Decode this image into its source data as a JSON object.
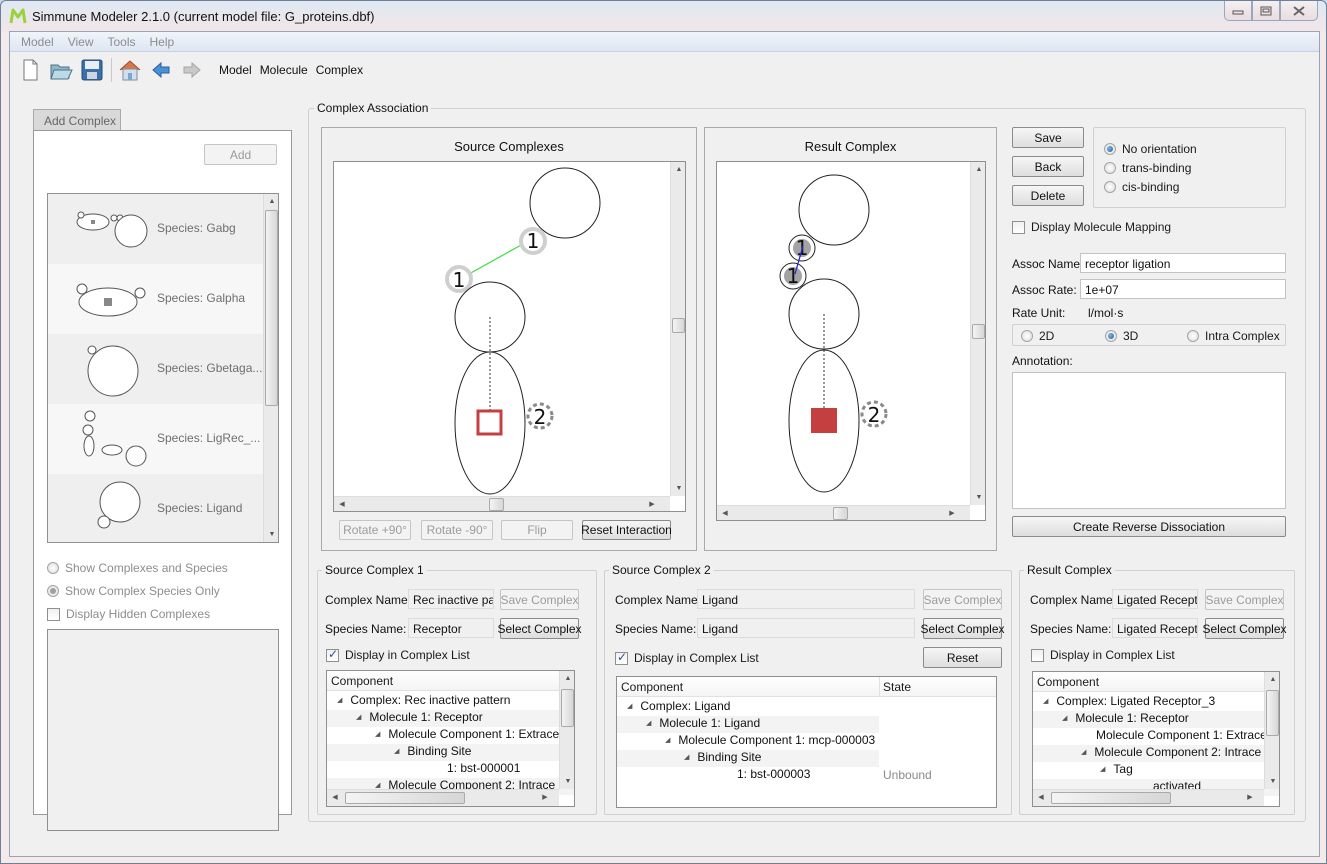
{
  "window": {
    "title": "Simmune Modeler  2.1.0 (current model file: G_proteins.dbf)",
    "controls": [
      "minimize",
      "maximize",
      "close"
    ]
  },
  "menubar": [
    "Model",
    "View",
    "Tools",
    "Help"
  ],
  "toolbar": {
    "icons": [
      "new-file-icon",
      "open-folder-icon",
      "save-disk-icon",
      "home-icon",
      "back-arrow-icon",
      "forward-arrow-icon"
    ],
    "links": [
      "Model",
      "Molecule",
      "Complex"
    ]
  },
  "left_panel": {
    "tab_label": "Add Complex",
    "add_button": "Add",
    "species": [
      {
        "label": "Species: Gabg"
      },
      {
        "label": "Species: Galpha"
      },
      {
        "label": "Species: Gbetaga..."
      },
      {
        "label": "Species: LigRec_..."
      },
      {
        "label": "Species: Ligand"
      }
    ],
    "options": {
      "show_complexes_and_species": "Show Complexes and Species",
      "show_complex_species_only": "Show Complex Species Only",
      "display_hidden": "Display Hidden Complexes",
      "selected": "Show Complex Species Only"
    }
  },
  "assoc": {
    "group_title": "Complex Association",
    "source_title": "Source Complexes",
    "result_title": "Result Complex",
    "site_labels": {
      "binding_a": "1",
      "binding_b": "1",
      "tag_site": "2"
    },
    "buttons": {
      "rotate_plus": "Rotate +90°",
      "rotate_minus": "Rotate -90°",
      "flip": "Flip",
      "reset_interaction": "Reset Interaction",
      "save": "Save",
      "back": "Back",
      "delete": "Delete",
      "create_reverse": "Create Reverse Dissociation"
    },
    "orientation": {
      "options": [
        "No orientation",
        "trans-binding",
        "cis-binding"
      ],
      "selected": "No orientation"
    },
    "display_mapping": "Display Molecule Mapping",
    "display_mapping_checked": false,
    "assoc_name_label": "Assoc Name:",
    "assoc_name": "receptor ligation",
    "assoc_rate_label": "Assoc Rate:",
    "assoc_rate": "1e+07",
    "rate_unit_label": "Rate Unit:",
    "rate_unit": "l/mol·s",
    "dimension": {
      "options": [
        "2D",
        "3D",
        "Intra Complex"
      ],
      "selected": "3D"
    },
    "annotation_label": "Annotation:",
    "annotation": "",
    "colors": {
      "binding_line": "#3ddc3d",
      "result_bond": "#2a2acc",
      "tag": "#c44040"
    }
  },
  "source1": {
    "title": "Source Complex 1",
    "complex_name_label": "Complex Name:",
    "complex_name": "Rec inactive patte",
    "species_name_label": "Species Name:",
    "species_name": "Receptor",
    "save_complex": "Save Complex",
    "select_complex": "Select Complex",
    "display_in_list": "Display in Complex List",
    "display_in_list_checked": true,
    "tree_header": "Component",
    "tree": [
      {
        "text": "Complex: Rec inactive pattern",
        "level": 0,
        "expanded": true
      },
      {
        "text": "Molecule 1: Receptor",
        "level": 1,
        "expanded": true
      },
      {
        "text": "Molecule Component 1: Extrace",
        "level": 2,
        "expanded": true
      },
      {
        "text": "Binding Site",
        "level": 3,
        "expanded": true
      },
      {
        "text": "1: bst-000001",
        "level": 5,
        "expanded": null
      },
      {
        "text": "Molecule Component 2: Intrace",
        "level": 2,
        "expanded": true
      }
    ]
  },
  "source2": {
    "title": "Source Complex 2",
    "complex_name_label": "Complex Name:",
    "complex_name": "Ligand",
    "species_name_label": "Species Name:",
    "species_name": "Ligand",
    "save_complex": "Save Complex",
    "select_complex": "Select Complex",
    "reset": "Reset",
    "display_in_list": "Display in Complex List",
    "display_in_list_checked": true,
    "tree_header": "Component",
    "tree_header_state": "State",
    "tree": [
      {
        "text": "Complex: Ligand",
        "level": 0,
        "expanded": true,
        "state": ""
      },
      {
        "text": "Molecule 1: Ligand",
        "level": 1,
        "expanded": true,
        "state": ""
      },
      {
        "text": "Molecule Component 1: mcp-000003",
        "level": 2,
        "expanded": true,
        "state": ""
      },
      {
        "text": "Binding Site",
        "level": 3,
        "expanded": true,
        "state": ""
      },
      {
        "text": "1: bst-000003",
        "level": 5,
        "expanded": null,
        "state": "Unbound"
      }
    ]
  },
  "result": {
    "title": "Result Complex",
    "complex_name_label": "Complex Name:",
    "complex_name": "Ligated Receptor",
    "species_name_label": "Species Name:",
    "species_name": "Ligated Receptor",
    "save_complex": "Save Complex",
    "select_complex": "Select Complex",
    "display_in_list": "Display in Complex List",
    "display_in_list_checked": false,
    "tree_header": "Component",
    "tree": [
      {
        "text": "Complex: Ligated Receptor_3",
        "level": 0,
        "expanded": true
      },
      {
        "text": "Molecule 1: Receptor",
        "level": 1,
        "expanded": true
      },
      {
        "text": "Molecule Component 1: Extrace",
        "level": 2,
        "expanded": null
      },
      {
        "text": "Molecule Component 2: Intrace",
        "level": 2,
        "expanded": true
      },
      {
        "text": "Tag",
        "level": 3,
        "expanded": true
      },
      {
        "text": "activated",
        "level": 5,
        "expanded": null
      }
    ]
  }
}
